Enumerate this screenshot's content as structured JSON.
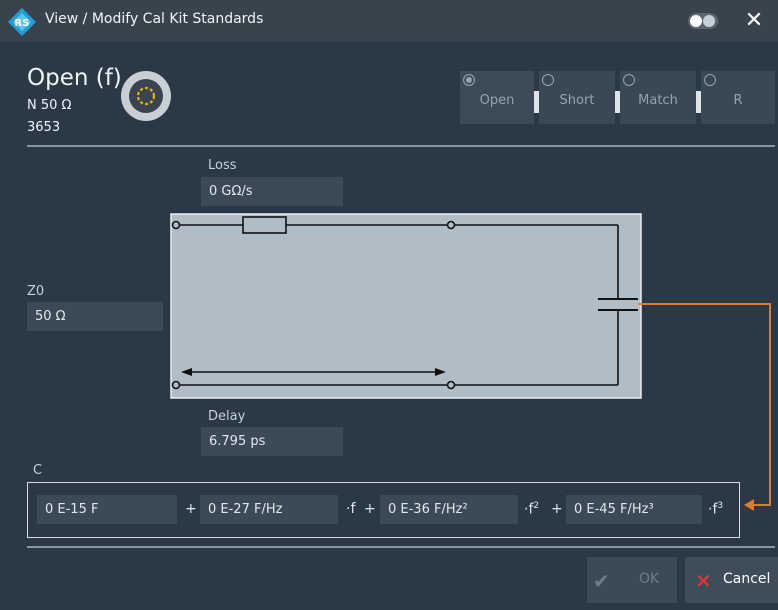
{
  "window": {
    "title": "View / Modify Cal Kit Standards",
    "close_glyph": "✕",
    "brand_colors": {
      "logo_blue": "#1e9fd6",
      "accent_orange": "#e07a2e",
      "cancel_red": "#ff3030"
    }
  },
  "standard": {
    "name": "Open (f)",
    "connector": "N 50 Ω",
    "number": "3653",
    "icon": "connector-female-icon"
  },
  "standard_types": [
    {
      "label": "Open",
      "selected": true
    },
    {
      "label": "Short",
      "selected": false
    },
    {
      "label": "Match",
      "selected": false
    },
    {
      "label": "R",
      "selected": false
    }
  ],
  "fields": {
    "loss": {
      "label": "Loss",
      "value": "0 GΩ/s"
    },
    "z0": {
      "label": "Z0",
      "value": "50 Ω"
    },
    "delay": {
      "label": "Delay",
      "value": "6.795 ps"
    }
  },
  "capacitance": {
    "label": "C",
    "c0": "0 E-15 F",
    "c1": "0 E-27 F/Hz",
    "c2": "0 E-36 F/Hz²",
    "c3": "0 E-45 F/Hz³",
    "plus": "+",
    "f1": "·f",
    "f2": "·f",
    "f2_exp": "2",
    "f3": "·f",
    "f3_exp": "3"
  },
  "buttons": {
    "ok": {
      "label": "OK",
      "icon": "checkmark-icon",
      "glyph": "✔",
      "enabled": false
    },
    "cancel": {
      "label": "Cancel",
      "icon": "cross-icon",
      "glyph": "✕",
      "enabled": true
    }
  }
}
